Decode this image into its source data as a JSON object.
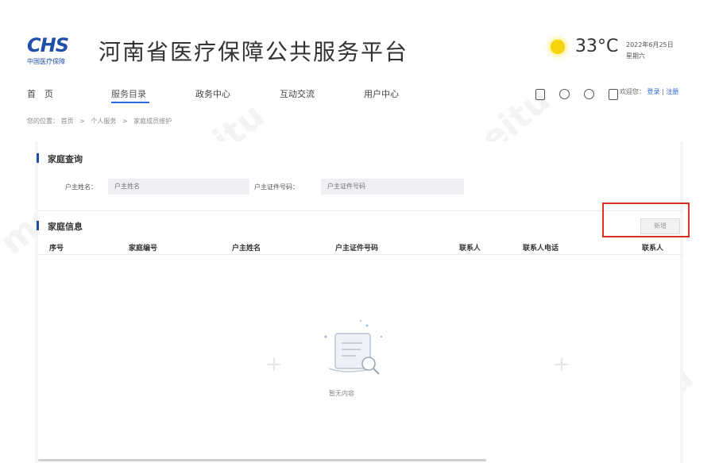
{
  "header": {
    "logo_mark": "CHS",
    "logo_sub": "中国医疗保障",
    "title": "河南省医疗保障公共服务平台",
    "weather": {
      "icon": "sun-icon",
      "temperature": "33°C"
    },
    "date": "2022年6月25日",
    "weekday": "星期六"
  },
  "nav": {
    "items": [
      {
        "label": "首　页"
      },
      {
        "label": "服务目录"
      },
      {
        "label": "政务中心"
      },
      {
        "label": "互动交流"
      },
      {
        "label": "用户中心"
      }
    ],
    "active_index": 1,
    "icons": [
      "mobile-icon",
      "wechat-icon",
      "weibo-icon",
      "phone-icon"
    ],
    "welcome": "欢迎您：",
    "login": "登录",
    "sep": "|",
    "register": "注册"
  },
  "breadcrumb": {
    "prefix": "您的位置：",
    "items": [
      "首页",
      "个人服务",
      "家庭成员维护"
    ],
    "sep": ">"
  },
  "query": {
    "title": "家庭查询",
    "fields": [
      {
        "label": "户主姓名：",
        "placeholder": "户主姓名"
      },
      {
        "label": "户主证件号码：",
        "placeholder": "户主证件号码"
      }
    ]
  },
  "info": {
    "title": "家庭信息",
    "add_button": "新增",
    "columns": [
      "序号",
      "家庭编号",
      "户主姓名",
      "户主证件号码",
      "联系人",
      "联系人电话",
      "联系人"
    ],
    "rows": [],
    "empty_text": "暂无内容"
  },
  "colors": {
    "brand": "#1f4fa8",
    "accent": "#2a6ae0",
    "highlight": "#d93025"
  }
}
